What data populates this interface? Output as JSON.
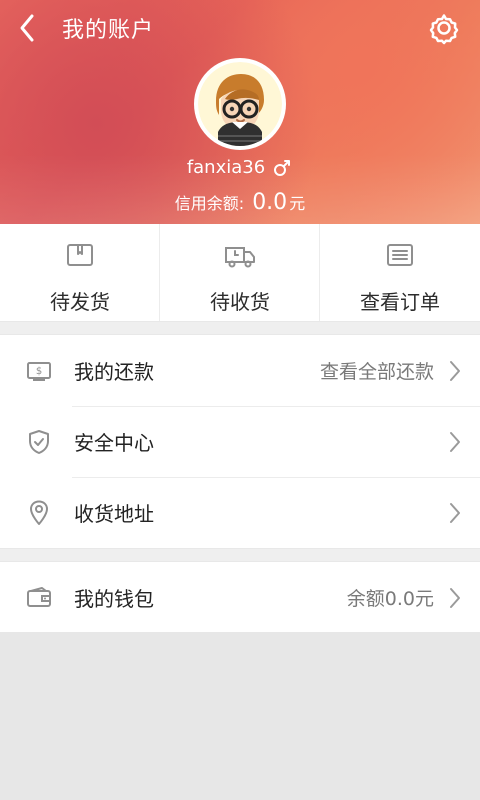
{
  "header": {
    "title": "我的账户",
    "username": "fanxia36",
    "credit_label": "信用余额:",
    "credit_value": "0.0",
    "credit_unit": "元"
  },
  "actions": [
    {
      "label": "待发货",
      "icon": "package-icon"
    },
    {
      "label": "待收货",
      "icon": "truck-icon"
    },
    {
      "label": "查看订单",
      "icon": "order-list-icon"
    }
  ],
  "menu": {
    "repayment": {
      "label": "我的还款",
      "hint": "查看全部还款",
      "icon": "repayment-icon"
    },
    "security": {
      "label": "安全中心",
      "icon": "shield-icon"
    },
    "address": {
      "label": "收货地址",
      "icon": "location-icon"
    }
  },
  "wallet": {
    "label": "我的钱包",
    "hint": "余额0.0元",
    "icon": "wallet-icon"
  },
  "colors": {
    "header_gradient_start": "#e15a56",
    "header_gradient_end": "#f3a07a",
    "divider": "#ececec",
    "text_primary": "#232323",
    "text_secondary": "#7a7a7a",
    "icon_gray": "#8f8f8f"
  }
}
